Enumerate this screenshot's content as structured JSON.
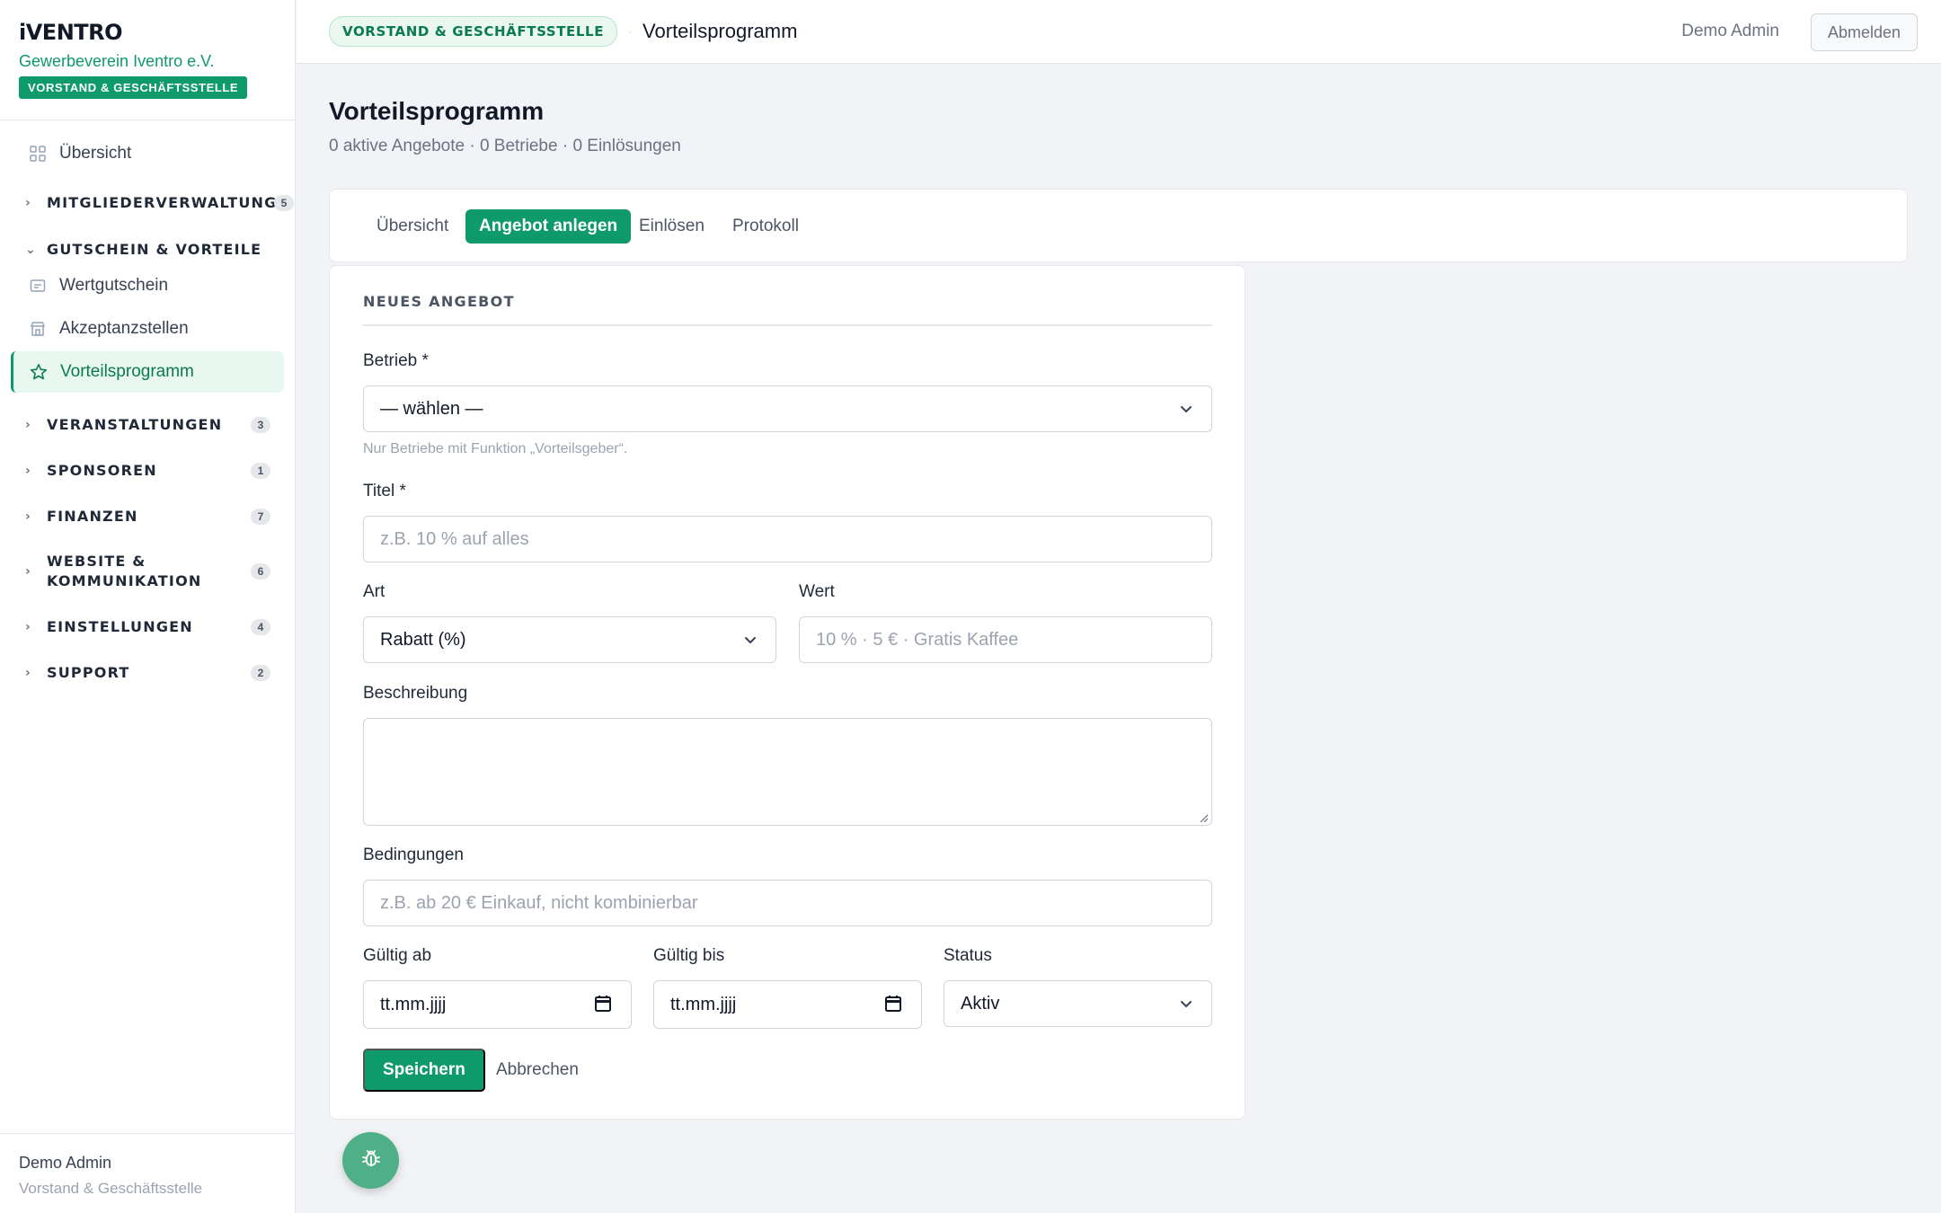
{
  "sidebar": {
    "logo": "iVENTRO",
    "org_name": "Gewerbeverein Iventro e.V.",
    "role_badge": "VORSTAND & GESCHÄFTSSTELLE",
    "overview": "Übersicht",
    "sections": {
      "members": {
        "label": "MITGLIEDERVERWALTUNG",
        "count": "5"
      },
      "vouchers": {
        "label": "GUTSCHEIN & VORTEILE"
      },
      "events": {
        "label": "VERANSTALTUNGEN",
        "count": "3"
      },
      "sponsors": {
        "label": "SPONSOREN",
        "count": "1"
      },
      "finance": {
        "label": "FINANZEN",
        "count": "7"
      },
      "website": {
        "label_line1": "WEBSITE &",
        "label_line2": "KOMMUNIKATION",
        "count": "6"
      },
      "settings": {
        "label": "EINSTELLUNGEN",
        "count": "4"
      },
      "support": {
        "label": "SUPPORT",
        "count": "2"
      }
    },
    "voucher_items": [
      "Wertgutschein",
      "Akzeptanzstellen",
      "Vorteilsprogramm"
    ],
    "footer": {
      "name": "Demo Admin",
      "role": "Vorstand & Geschäftsstelle"
    }
  },
  "topbar": {
    "badge": "VORSTAND & GESCHÄFTSSTELLE",
    "separator": "·",
    "title": "Vorteilsprogramm",
    "user": "Demo Admin",
    "logout": "Abmelden"
  },
  "page": {
    "title": "Vorteilsprogramm",
    "subtitle": "0 aktive Angebote · 0 Betriebe · 0 Einlösungen"
  },
  "tabs": [
    "Übersicht",
    "Angebot anlegen",
    "Einlösen",
    "Protokoll"
  ],
  "active_tab": "Angebot anlegen",
  "form": {
    "heading": "NEUES ANGEBOT",
    "betrieb": {
      "label": "Betrieb *",
      "value": "— wählen —",
      "hint": "Nur Betriebe mit Funktion „Vorteilsgeber“."
    },
    "titel": {
      "label": "Titel *",
      "placeholder": "z.B. 10 % auf alles"
    },
    "art": {
      "label": "Art",
      "value": "Rabatt (%)"
    },
    "wert": {
      "label": "Wert",
      "placeholder": "10 % · 5 € · Gratis Kaffee"
    },
    "beschreibung": {
      "label": "Beschreibung"
    },
    "bedingungen": {
      "label": "Bedingungen",
      "placeholder": "z.B. ab 20 € Einkauf, nicht kombinierbar"
    },
    "gueltig_ab": {
      "label": "Gültig ab",
      "value": "tt.mm.jjjj"
    },
    "gueltig_bis": {
      "label": "Gültig bis",
      "value": "tt.mm.jjjj"
    },
    "status": {
      "label": "Status",
      "value": "Aktiv"
    },
    "save": "Speichern",
    "cancel": "Abbrechen"
  },
  "colors": {
    "accent": "#0e9a6a",
    "accent_light": "#e8f7ef",
    "background": "#f1f3f6",
    "fab": "#4faf86"
  },
  "icons": [
    "grid-icon",
    "chevron-right-icon",
    "chevron-down-icon",
    "ticket-icon",
    "store-icon",
    "star-icon",
    "calendar-icon",
    "bug-icon"
  ]
}
